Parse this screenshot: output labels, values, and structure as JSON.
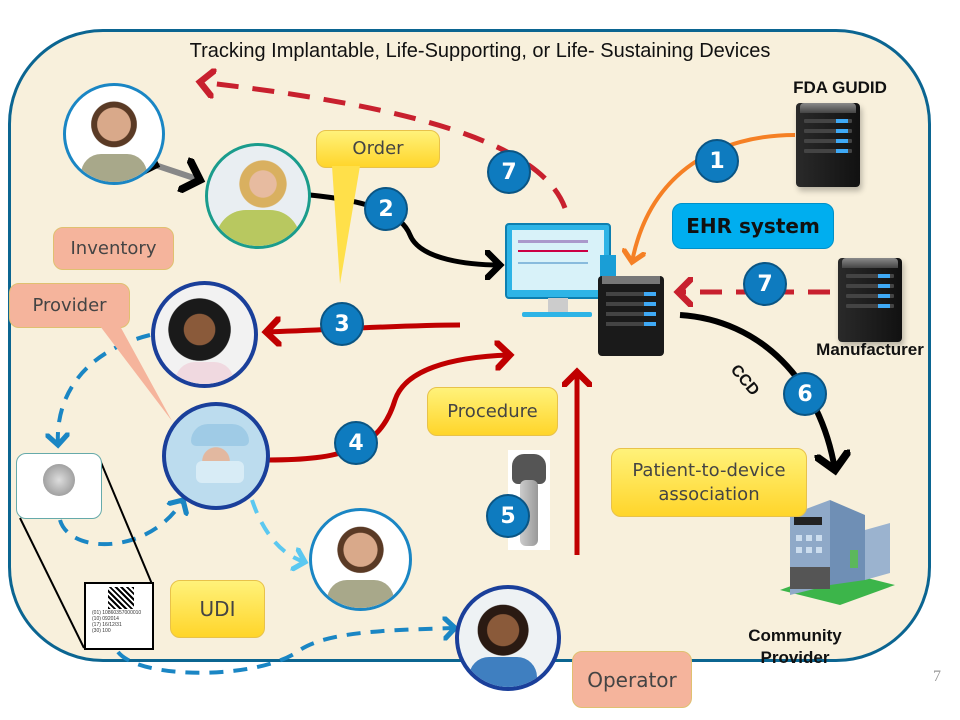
{
  "title": "Tracking Implantable, Life-Supporting, or Life- Sustaining Devices",
  "page_number": "7",
  "colors": {
    "border": "#0b6591",
    "background": "#f8f0dc",
    "badge": "#0e7bbf",
    "red_arrow": "#c00000",
    "dashed_red": "#c8202e",
    "orange_arrow": "#f58025",
    "blue_dashed": "#1a86c4",
    "light_blue_dashed": "#5bc8f0",
    "callout_yellow": "#ffe04a",
    "callout_salmon": "#f5b49c",
    "callout_blue": "#00aeef"
  },
  "nodes": {
    "fda_gudid": "FDA GUDID",
    "manufacturer": "Manufacturer",
    "community_provider": "Community Provider",
    "ehr_system": "EHR system"
  },
  "callouts": {
    "order": "Order",
    "inventory": "Inventory",
    "provider": "Provider",
    "procedure": "Procedure",
    "patient_to_device": "Patient-to-device association",
    "udi": "UDI",
    "operator": "Operator"
  },
  "edge_labels": {
    "ccd": "CCD"
  },
  "steps": {
    "s1": "1",
    "s2": "2",
    "s3": "3",
    "s4": "4",
    "s5": "5",
    "s6": "6",
    "s7a": "7",
    "s7b": "7"
  },
  "udi_label": {
    "lines": [
      "(01) 10860357000010",
      "(10) 092014",
      "(17) 16/12/31",
      "(30) 100"
    ]
  },
  "people": [
    {
      "role": "patient-soldier-top"
    },
    {
      "role": "clerk-order"
    },
    {
      "role": "inventory-staff"
    },
    {
      "role": "surgeon-provider"
    },
    {
      "role": "patient-soldier-bottom"
    },
    {
      "role": "operator-nurse"
    }
  ]
}
